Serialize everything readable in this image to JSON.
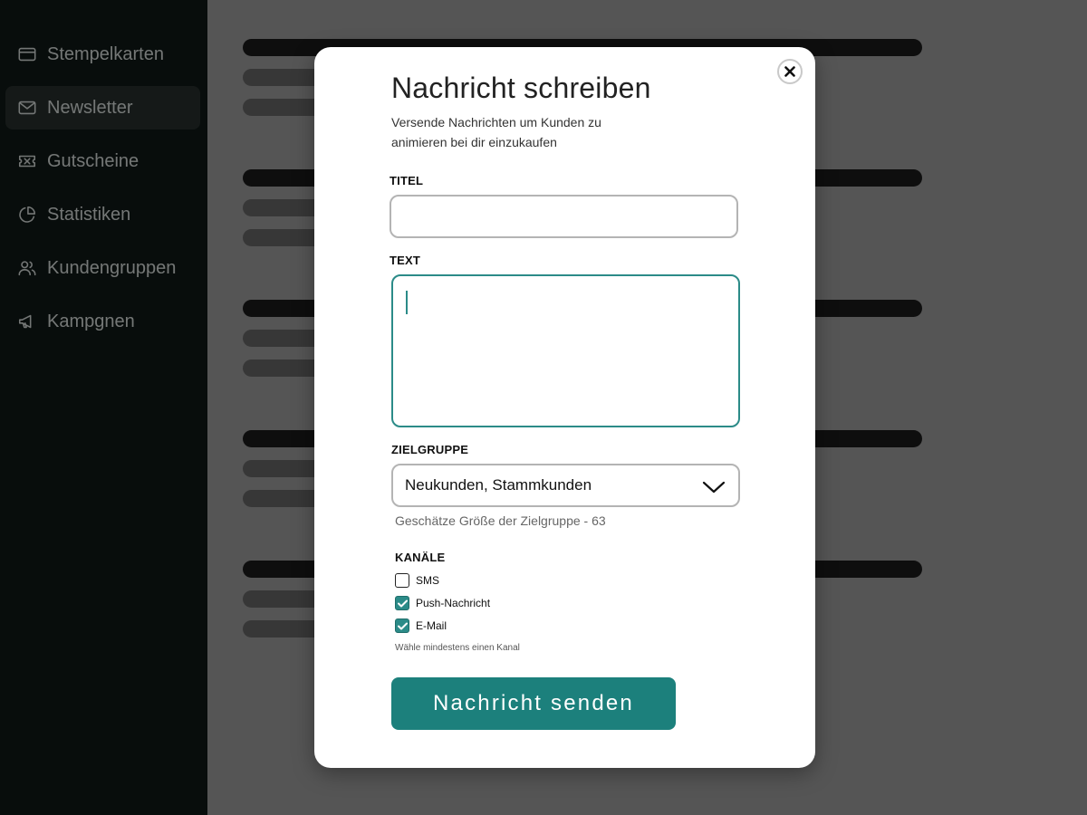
{
  "sidebar": {
    "items": [
      {
        "label": "Stempelkarten",
        "icon": "card-icon",
        "active": false
      },
      {
        "label": "Newsletter",
        "icon": "mail-icon",
        "active": true
      },
      {
        "label": "Gutscheine",
        "icon": "ticket-icon",
        "active": false
      },
      {
        "label": "Statistiken",
        "icon": "pie-chart-icon",
        "active": false
      },
      {
        "label": "Kundengruppen",
        "icon": "users-icon",
        "active": false
      },
      {
        "label": "Kampgnen",
        "icon": "megaphone-icon",
        "active": false
      }
    ]
  },
  "modal": {
    "title": "Nachricht schreiben",
    "subtitle": "Versende Nachrichten um Kunden zu animieren bei dir einzukaufen",
    "titel_label": "TITEL",
    "titel_value": "",
    "text_label": "TEXT",
    "text_value": "",
    "zielgruppe_label": "ZIELGRUPPE",
    "zielgruppe_value": "Neukunden, Stammkunden",
    "estimate": "Geschätze Größe der Zielgruppe - 63",
    "kanaele_label": "KANÄLE",
    "channels": [
      {
        "label": "SMS",
        "checked": false
      },
      {
        "label": "Push-Nachricht",
        "checked": true
      },
      {
        "label": "E-Mail",
        "checked": true
      }
    ],
    "channel_hint": "Wähle mindestens einen Kanal",
    "send_label": "Nachricht senden"
  },
  "colors": {
    "accent": "#1c807c",
    "focus_border": "#2b8b88",
    "sidebar_bg": "#111a18"
  }
}
